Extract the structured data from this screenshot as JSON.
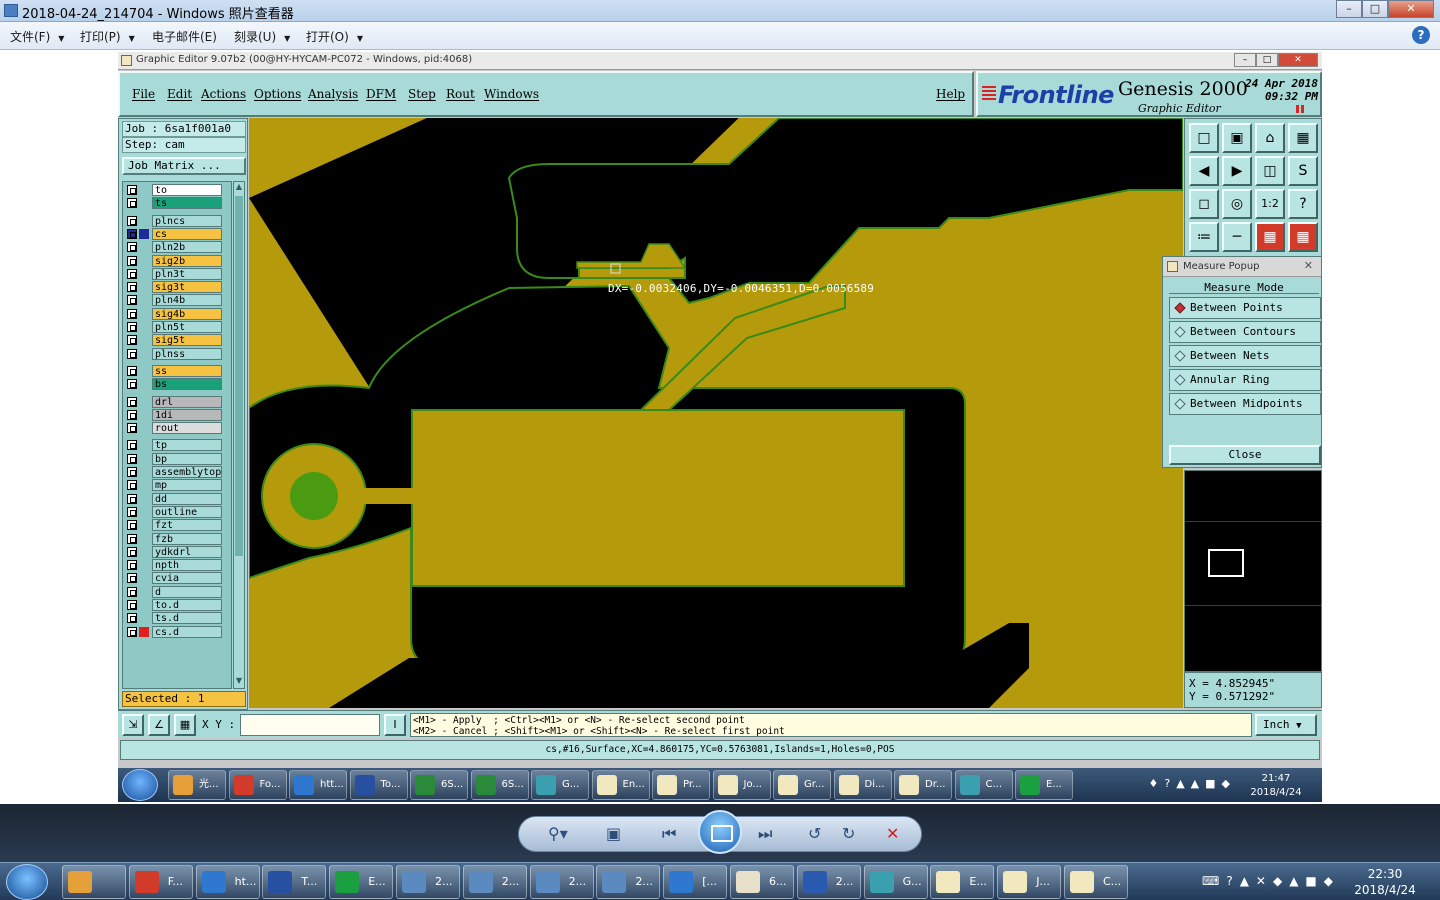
{
  "viewer": {
    "title": "2018-04-24_214704 - Windows 照片查看器",
    "menu": [
      "文件(F)",
      "打印(P)",
      "电子邮件(E)",
      "刻录(U)",
      "打开(O)"
    ]
  },
  "app": {
    "title": "Graphic Editor 9.07b2 (00@HY-HYCAM-PC072 - Windows, pid:4068)",
    "menu": [
      "File",
      "Edit",
      "Actions",
      "Options",
      "Analysis",
      "DFM",
      "Step",
      "Rout",
      "Windows"
    ],
    "help": "Help",
    "logo": {
      "brand": "Frontline",
      "product": "Genesis 2000",
      "subtitle": "Graphic Editor",
      "date": "24 Apr 2018",
      "time": "09:32 PM"
    }
  },
  "job": {
    "job_line": "Job : 6sa1f001a0",
    "step_line": "Step: cam",
    "matrix_button": "Job Matrix ...",
    "selected": "Selected : 1"
  },
  "layers": [
    {
      "name": "to",
      "color": "#ffffff"
    },
    {
      "name": "ts",
      "color": "#1aa17a"
    },
    {
      "name": "plncs",
      "color": "#a8dad8"
    },
    {
      "name": "cs",
      "color": "#f5c242",
      "active": true
    },
    {
      "name": "pln2b",
      "color": "#a8dad8"
    },
    {
      "name": "sig2b",
      "color": "#f5c242"
    },
    {
      "name": "pln3t",
      "color": "#a8dad8"
    },
    {
      "name": "sig3t",
      "color": "#f5c242"
    },
    {
      "name": "pln4b",
      "color": "#a8dad8"
    },
    {
      "name": "sig4b",
      "color": "#f5c242"
    },
    {
      "name": "pln5t",
      "color": "#a8dad8"
    },
    {
      "name": "sig5t",
      "color": "#f5c242"
    },
    {
      "name": "plnss",
      "color": "#a8dad8"
    },
    {
      "name": "ss",
      "color": "#f5c242"
    },
    {
      "name": "bs",
      "color": "#1aa17a"
    },
    {
      "name": "drl",
      "color": "#b8b8b8"
    },
    {
      "name": "1di",
      "color": "#b8b8b8"
    },
    {
      "name": "rout",
      "color": "#dcdcdc"
    },
    {
      "name": "tp",
      "color": "#a8dad8"
    },
    {
      "name": "bp",
      "color": "#a8dad8"
    },
    {
      "name": "assemblytop",
      "color": "#a8dad8"
    },
    {
      "name": "mp",
      "color": "#a8dad8"
    },
    {
      "name": "dd",
      "color": "#a8dad8"
    },
    {
      "name": "outline",
      "color": "#a8dad8"
    },
    {
      "name": "fzt",
      "color": "#a8dad8"
    },
    {
      "name": "fzb",
      "color": "#a8dad8"
    },
    {
      "name": "ydkdrl",
      "color": "#a8dad8"
    },
    {
      "name": "npth",
      "color": "#a8dad8"
    },
    {
      "name": "cvia",
      "color": "#a8dad8"
    },
    {
      "name": "d",
      "color": "#a8dad8"
    },
    {
      "name": "to.d",
      "color": "#a8dad8"
    },
    {
      "name": "ts.d",
      "color": "#a8dad8"
    },
    {
      "name": "cs.d",
      "color": "#a8dad8",
      "marker": "#e02020"
    }
  ],
  "canvas": {
    "measure_text": "DX=-0.0032406,DY=-0.0046351,D=0.0056589",
    "colors": {
      "copper": "#b59a0b",
      "space": "#000000",
      "outline": "#3a8a1a",
      "pad_center": "#4a9a12"
    }
  },
  "measure_popup": {
    "title": "Measure Popup",
    "header": "Measure Mode",
    "options": [
      "Between Points",
      "Between Contours",
      "Between Nets",
      "Annular Ring",
      "Between Midpoints"
    ],
    "selected_index": 0,
    "close": "Close"
  },
  "coords": {
    "x": "X = 4.852945\"",
    "y": "Y = 0.571292\""
  },
  "bottom": {
    "xy_label": "X Y :",
    "hint_line1": "<M1> - Apply  ; <Ctrl><M1> or <N> - Re-select second point",
    "hint_line2": "<M2> - Cancel ; <Shift><M1> or <Shift><N> - Re-select first point",
    "units": "Inch",
    "status": "cs,#16,Surface,XC=4.860175,YC=0.5763081,Islands=1,Holes=0,POS"
  },
  "inner_taskbar": {
    "items": [
      "光...",
      "Fo...",
      "htt...",
      "To...",
      "6S...",
      "6S...",
      "G...",
      "En...",
      "Pr...",
      "Jo...",
      "Gr...",
      "Di...",
      "Dr...",
      "C...",
      "E..."
    ],
    "time": "21:47",
    "date": "2018/4/24"
  },
  "taskbar": {
    "items": [
      "",
      "F...",
      "ht...",
      "T...",
      "E...",
      "2...",
      "2...",
      "2...",
      "2...",
      "[...",
      "6...",
      "2...",
      "G...",
      "E...",
      "J...",
      "C..."
    ],
    "time": "22:30",
    "date": "2018/4/24"
  }
}
